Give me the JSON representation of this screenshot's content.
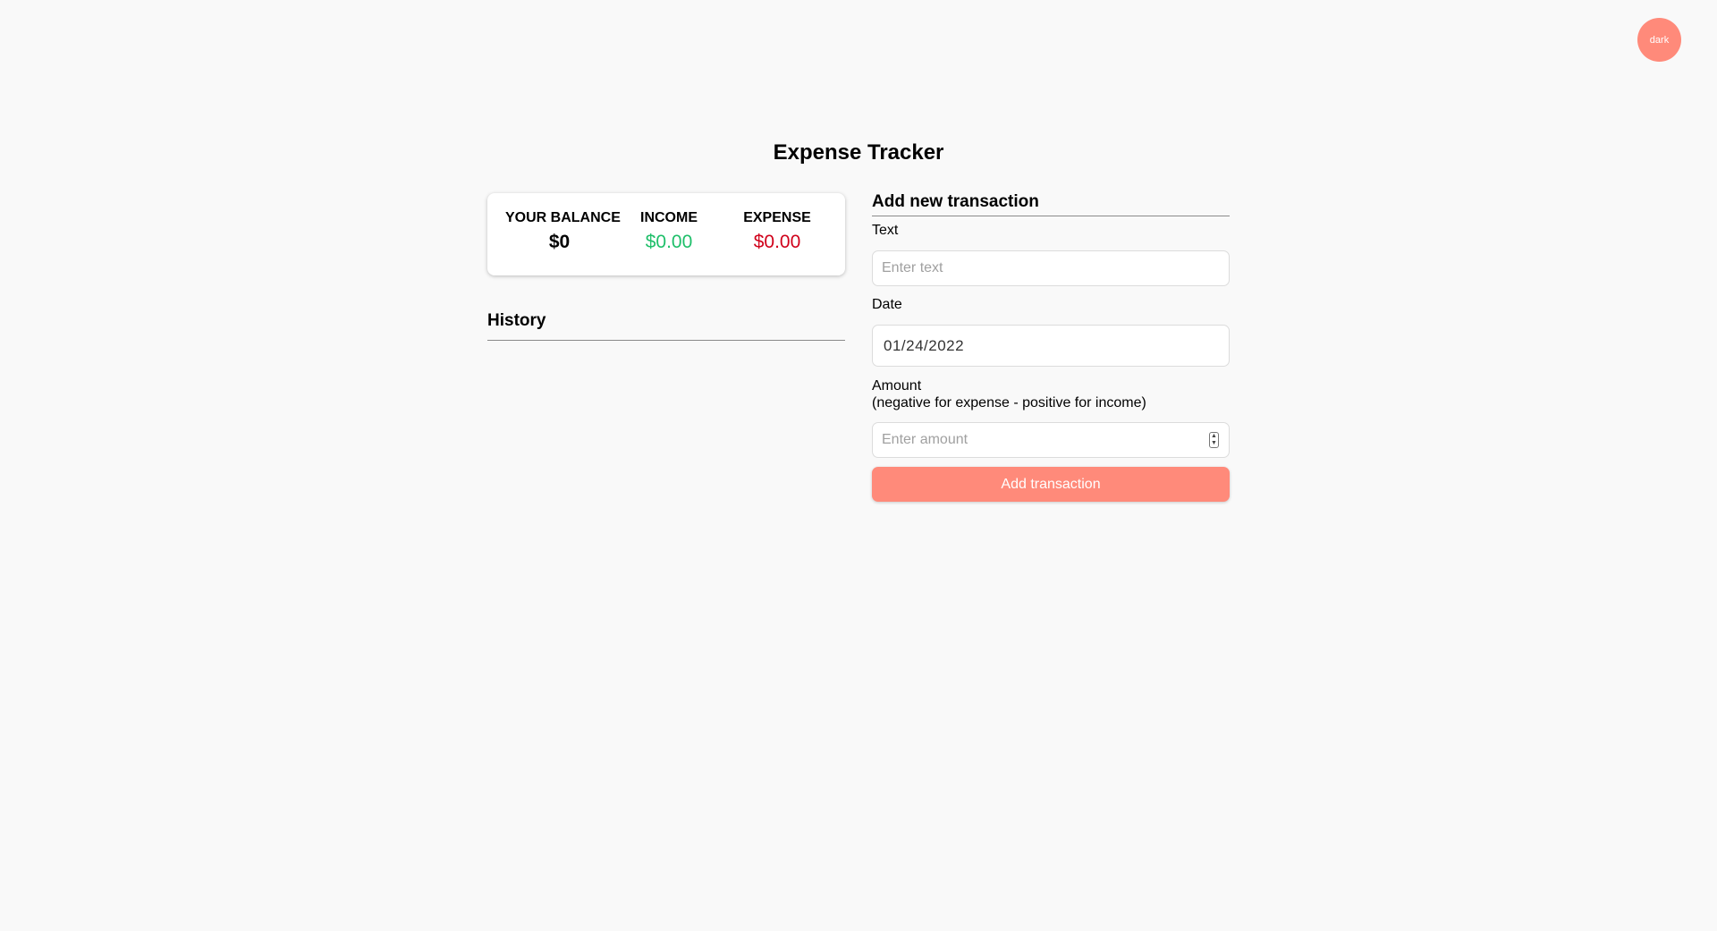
{
  "theme_toggle": {
    "label": "dark"
  },
  "title": "Expense Tracker",
  "summary": {
    "balance_label": "YOUR BALANCE",
    "balance_value": "$0",
    "income_label": "INCOME",
    "income_value": "$0.00",
    "expense_label": "EXPENSE",
    "expense_value": "$0.00"
  },
  "history": {
    "title": "History",
    "items": []
  },
  "form": {
    "title": "Add new transaction",
    "text_label": "Text",
    "text_placeholder": "Enter text",
    "date_label": "Date",
    "date_value": "01/24/2022",
    "amount_label": "Amount",
    "amount_hint": "(negative for expense - positive for income)",
    "amount_placeholder": "Enter amount",
    "submit_label": "Add transaction"
  },
  "colors": {
    "accent": "#ff8a7a",
    "income": "#1fbf6a",
    "expense": "#d0021b",
    "background": "#f9f9f9"
  }
}
